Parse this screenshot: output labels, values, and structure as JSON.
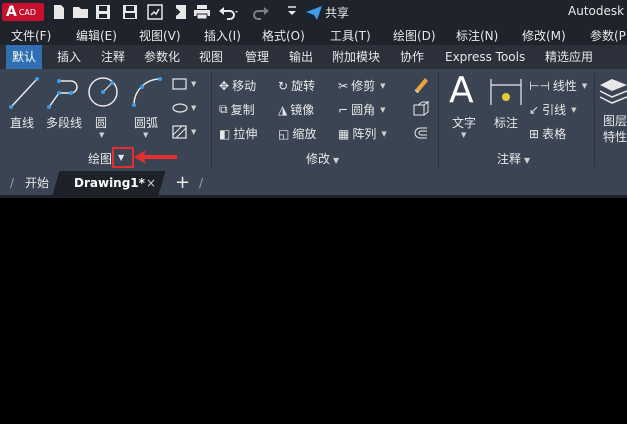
{
  "titlebar": {
    "logo_letter": "A",
    "logo_text": "CAD",
    "quick_access_icons": [
      "new-file-icon",
      "open-folder-icon",
      "save-icon",
      "save-as-icon",
      "plot-icon",
      "import-icon",
      "print-icon",
      "undo-icon",
      "redo-icon",
      "customize-dropdown-icon"
    ],
    "share_label": "共享",
    "brand": "Autodesk"
  },
  "menubar": {
    "items": [
      "文件(F)",
      "编辑(E)",
      "视图(V)",
      "插入(I)",
      "格式(O)",
      "工具(T)",
      "绘图(D)",
      "标注(N)",
      "修改(M)",
      "参数(P"
    ]
  },
  "ribbon_tabs": {
    "items": [
      "默认",
      "插入",
      "注释",
      "参数化",
      "视图",
      "管理",
      "输出",
      "附加模块",
      "协作",
      "Express Tools",
      "精选应用"
    ],
    "active": "默认"
  },
  "draw_panel": {
    "title": "绘图",
    "tools": [
      "直线",
      "多段线",
      "圆",
      "圆弧"
    ]
  },
  "modify_panel": {
    "title": "修改",
    "col1": [
      "移动",
      "复制",
      "拉伸"
    ],
    "col2": [
      "旋转",
      "镜像",
      "缩放"
    ],
    "col3": [
      "修剪",
      "圆角",
      "阵列"
    ]
  },
  "annotation_panel": {
    "title": "注释",
    "text_label": "文字",
    "dim_label": "标注",
    "linear_label": "线性",
    "leader_label": "引线",
    "table_label": "表格"
  },
  "layers_panel": {
    "label_line1": "图层",
    "label_line2": "特性"
  },
  "doc_tabs": {
    "start": "开始",
    "drawing": "Drawing1*",
    "close": "×",
    "add": "+"
  },
  "colors": {
    "accent": "#2f6fb2",
    "highlight": "#e52e2e",
    "ribbon_bg": "#3b4453",
    "menubar_bg": "#1f232b"
  }
}
